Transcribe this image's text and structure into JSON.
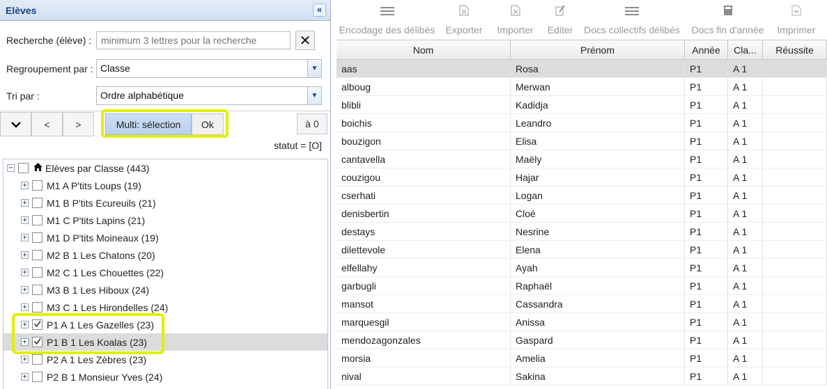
{
  "left": {
    "title": "Elèves",
    "collapse_glyph": "«",
    "search": {
      "label": "Recherche (élève) :",
      "placeholder": "minimum 3 lettres pour la recherche",
      "clear_glyph": "✕"
    },
    "grouping": {
      "label": "Regroupement par :",
      "value": "Classe"
    },
    "sort": {
      "label": "Tri par :",
      "value": "Ordre alphabétique"
    },
    "toolbar": {
      "expand_glyph": "⌄",
      "prev_label": "<",
      "next_label": ">",
      "multi_label": "Multi: sélection",
      "ok_label": "Ok",
      "count_label": "à 0"
    },
    "statut": "statut = [O]",
    "tree": {
      "root": "Elèves par Classe (443)",
      "nodes": [
        {
          "label": "M1 A P'tits Loups (19)",
          "checked": false
        },
        {
          "label": "M1 B P'tits Ecureuils (21)",
          "checked": false
        },
        {
          "label": "M1 C P'tits Lapins (21)",
          "checked": false
        },
        {
          "label": "M1 D P'tits Moineaux (19)",
          "checked": false
        },
        {
          "label": "M2 B 1 Les Chatons (20)",
          "checked": false
        },
        {
          "label": "M2 C 1 Les Chouettes (22)",
          "checked": false
        },
        {
          "label": "M3 B 1 Les Hiboux (24)",
          "checked": false
        },
        {
          "label": "M3 C 1 Les Hirondelles (24)",
          "checked": false
        },
        {
          "label": "P1 A 1 Les Gazelles (23)",
          "checked": true
        },
        {
          "label": "P1 B 1 Les Koalas (23)",
          "checked": true
        },
        {
          "label": "P2 A 1 Les Zèbres (23)",
          "checked": false
        },
        {
          "label": "P2 B 1 Monsieur Yves (24)",
          "checked": false
        }
      ]
    }
  },
  "right": {
    "toolbar": [
      {
        "label": "Encodage des délibés",
        "icon": "list-icon"
      },
      {
        "label": "Exporter",
        "icon": "export-icon"
      },
      {
        "label": "Importer",
        "icon": "import-icon"
      },
      {
        "label": "Editer",
        "icon": "edit-icon"
      },
      {
        "label": "Docs collectifs délibés",
        "icon": "list-icon"
      },
      {
        "label": "Docs fin d'année",
        "icon": "book-icon"
      },
      {
        "label": "Imprimer",
        "icon": "print-icon"
      }
    ],
    "columns": [
      "Nom",
      "Prénom",
      "Année",
      "Cla...",
      "Réussite"
    ],
    "rows": [
      [
        "aas",
        "Rosa",
        "P1",
        "A 1",
        ""
      ],
      [
        "alboug",
        "Merwan",
        "P1",
        "A 1",
        ""
      ],
      [
        "blibli",
        "Kadidja",
        "P1",
        "A 1",
        ""
      ],
      [
        "boichis",
        "Leandro",
        "P1",
        "A 1",
        ""
      ],
      [
        "bouzigon",
        "Elisa",
        "P1",
        "A 1",
        ""
      ],
      [
        "cantavella",
        "Maëly",
        "P1",
        "A 1",
        ""
      ],
      [
        "couzigou",
        "Hajar",
        "P1",
        "A 1",
        ""
      ],
      [
        "cserhati",
        "Logan",
        "P1",
        "A 1",
        ""
      ],
      [
        "denisbertin",
        "Cloé",
        "P1",
        "A 1",
        ""
      ],
      [
        "destays",
        "Nesrine",
        "P1",
        "A 1",
        ""
      ],
      [
        "dilettevole",
        "Elena",
        "P1",
        "A 1",
        ""
      ],
      [
        "elfellahy",
        "Ayah",
        "P1",
        "A 1",
        ""
      ],
      [
        "garbugli",
        "Raphaël",
        "P1",
        "A 1",
        ""
      ],
      [
        "mansot",
        "Cassandra",
        "P1",
        "A 1",
        ""
      ],
      [
        "marquesgil",
        "Anissa",
        "P1",
        "A 1",
        ""
      ],
      [
        "mendozagonzales",
        "Gaspard",
        "P1",
        "A 1",
        ""
      ],
      [
        "morsia",
        "Amelia",
        "P1",
        "A 1",
        ""
      ],
      [
        "nival",
        "Sakina",
        "P1",
        "A 1",
        ""
      ]
    ]
  }
}
